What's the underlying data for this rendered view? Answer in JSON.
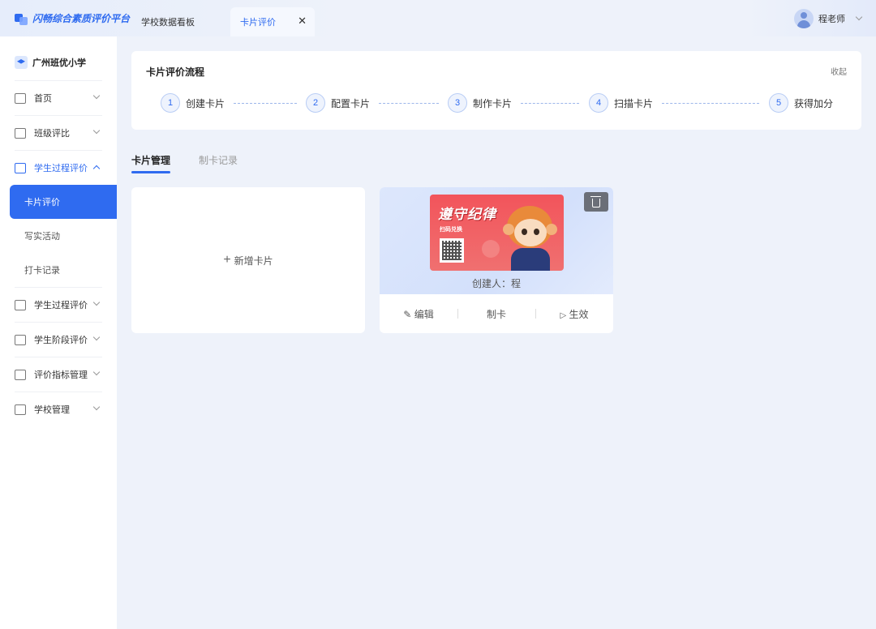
{
  "header": {
    "app_name": "闪畅综合素质评价平台",
    "tabs": [
      {
        "label": "学校数据看板"
      },
      {
        "label": "卡片评价",
        "close": "✕"
      }
    ],
    "user_name": "程老师"
  },
  "sidebar": {
    "school": "广州班优小学",
    "items": [
      {
        "label": "首页",
        "icon": "home-icon"
      },
      {
        "label": "班级评比",
        "icon": "person-icon"
      },
      {
        "label": "学生过程评价",
        "icon": "document-icon",
        "expanded": true
      }
    ],
    "sub_items": [
      {
        "label": "卡片评价",
        "active": true
      },
      {
        "label": "写实活动"
      },
      {
        "label": "打卡记录"
      }
    ],
    "items_after": [
      {
        "label": "学生过程评价",
        "icon": "document-icon"
      },
      {
        "label": "学生阶段评价",
        "icon": "message-icon"
      },
      {
        "label": "评价指标管理",
        "icon": "message-icon"
      },
      {
        "label": "学校管理",
        "icon": "document-icon"
      }
    ]
  },
  "flow": {
    "title": "卡片评价流程",
    "collapse": "收起",
    "steps": [
      {
        "num": "1",
        "label": "创建卡片"
      },
      {
        "num": "2",
        "label": "配置卡片"
      },
      {
        "num": "3",
        "label": "制作卡片"
      },
      {
        "num": "4",
        "label": "扫描卡片"
      },
      {
        "num": "5",
        "label": "获得加分"
      }
    ]
  },
  "content_tabs": [
    {
      "label": "卡片管理",
      "active": true
    },
    {
      "label": "制卡记录"
    }
  ],
  "add_card": {
    "icon": "+",
    "label": "新增卡片"
  },
  "card": {
    "image_title": "遵守纪律",
    "image_subtitle": "扫码兑换",
    "creator": "创建人：程",
    "actions": [
      {
        "label": "编辑",
        "icon": "pencil-icon"
      },
      {
        "label": "制卡"
      },
      {
        "label": "生效",
        "icon": "play-icon"
      }
    ]
  },
  "colors": {
    "accent": "#2f6bf0",
    "background": "#eef2fa"
  }
}
